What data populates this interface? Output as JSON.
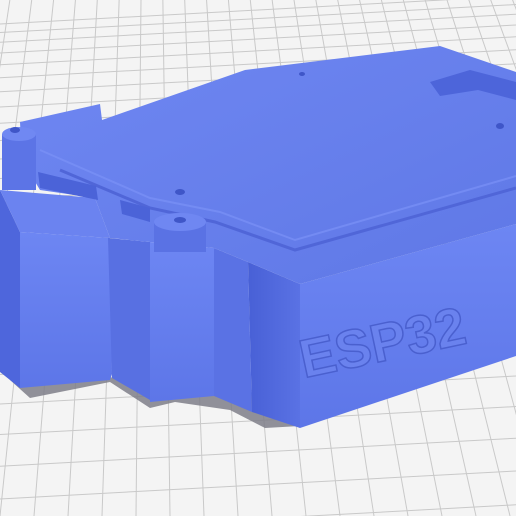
{
  "viewport": {
    "background_color": "#f4f4f4",
    "grid_line_color": "#c9c9c9",
    "grid_major_color": "#b5b5b5"
  },
  "model": {
    "color": "#6a82ee",
    "shadow_color": "#8a8a94",
    "embossed_text": "ESP32"
  }
}
